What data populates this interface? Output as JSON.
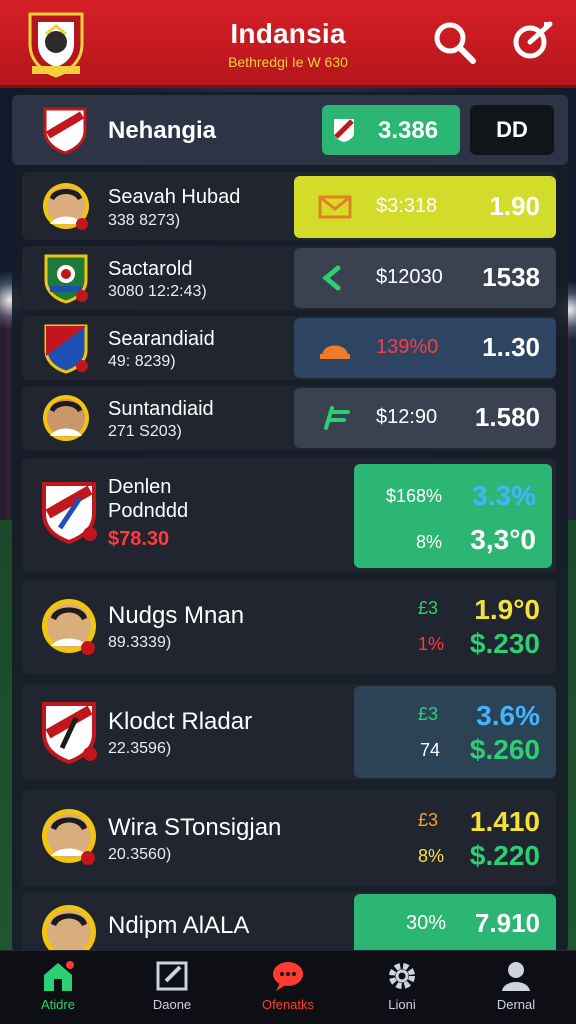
{
  "header": {
    "title": "Indansia",
    "subtitle": "Bethredgi Ie W 630"
  },
  "top": {
    "team": "Nehangia",
    "odds": "3.386",
    "menu_label": "DD"
  },
  "rows": [
    {
      "name": "Seavah Hubad",
      "sub": "338 8273)",
      "amount": "$3:318",
      "odd": "1.90",
      "style": "yellow",
      "icon": "envelope-icon"
    },
    {
      "name": "Sactarold",
      "sub": "3080 12:2:43)",
      "amount": "$12030",
      "odd": "1538",
      "style": "grey",
      "icon": "arrow-icon"
    },
    {
      "name": "Searandiaid",
      "sub": "49: 8239)",
      "amount": "139%0",
      "odd": "1..30",
      "style": "blue",
      "icon": "helmet-icon"
    },
    {
      "name": "Suntandiaid",
      "sub": "271 S203)",
      "amount": "$12:90",
      "odd": "1.580",
      "style": "grey",
      "icon": "flag-icon"
    }
  ],
  "featured": [
    {
      "name": "Denlen",
      "name2": "Podnddd",
      "sub": "$78.30",
      "l1": "$168%",
      "r1": "3.3%",
      "l2": "8%",
      "r2": "3,3°0"
    },
    {
      "name": "Nudgs Mnan",
      "sub": "89.3339)",
      "l1": "£3",
      "r1": "1.9°0",
      "l2": "1%",
      "r2": "$.230"
    },
    {
      "name": "Klodct Rladar",
      "sub": "22.3596)",
      "l1": "£3",
      "r1": "3.6%",
      "l2": "74",
      "r2": "$.260"
    },
    {
      "name": "Wira STonsigjan",
      "sub": "20.3560)",
      "l1": "£3",
      "r1": "1.410",
      "l2": "8%",
      "r2": "$.220"
    },
    {
      "name": "Ndipm AlALA",
      "l1": "30%",
      "r1": "7.910"
    }
  ],
  "nav": [
    {
      "label": "Atidre",
      "icon": "home-icon"
    },
    {
      "label": "Daone",
      "icon": "edit-icon"
    },
    {
      "label": "Ofenatks",
      "icon": "chat-icon"
    },
    {
      "label": "Lioni",
      "icon": "gear-icon"
    },
    {
      "label": "Dernal",
      "icon": "profile-icon"
    }
  ],
  "colors": {
    "header_red": "#d61f26",
    "accent_green": "#2bb673",
    "accent_yellow": "#d4dc2b",
    "accent_blue": "#46b3ff",
    "odds_yellow": "#f4e23a"
  }
}
